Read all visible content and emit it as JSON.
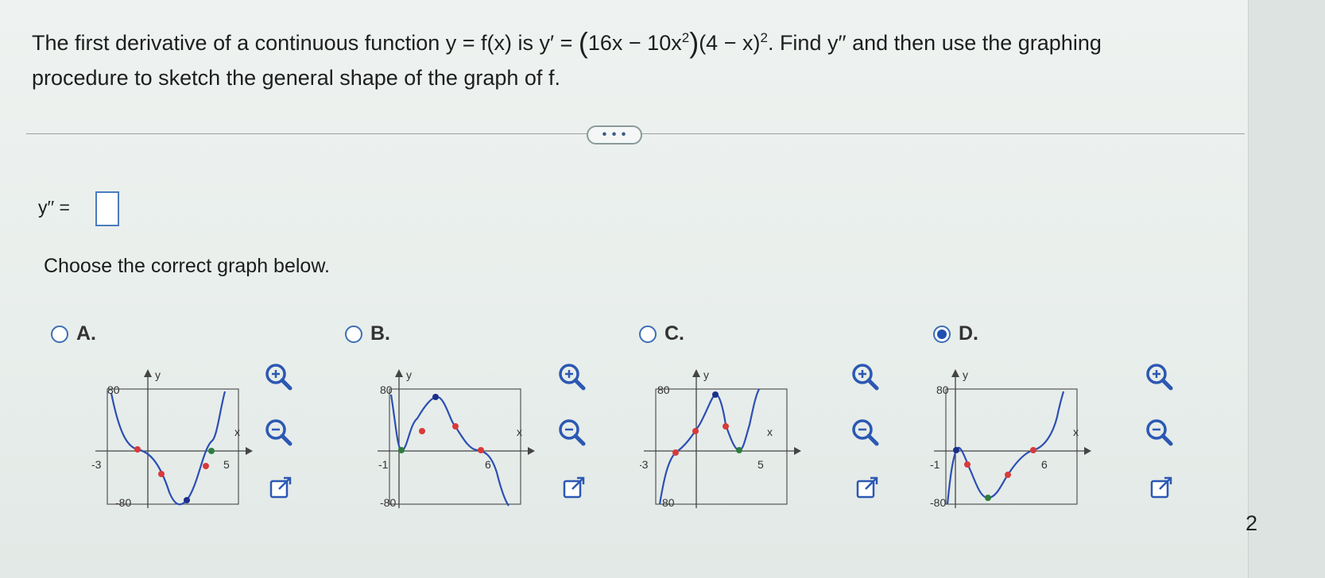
{
  "question": {
    "part1": "The first derivative of a continuous function y = f(x) is y′ = ",
    "factor1": "16x − 10x",
    "exp1": "2",
    "factor2": "(4 − x)",
    "exp2": "2",
    "part2": ". Find y′′ and then use the graphing procedure to sketch the general shape of the graph of f."
  },
  "more_button": "• • •",
  "answer": {
    "label": "y′′ =",
    "value": ""
  },
  "choose_prompt": "Choose the correct graph below.",
  "options": [
    {
      "label": "A.",
      "selected": false,
      "axis": {
        "x": "x",
        "y": "y",
        "ymax": "80",
        "ymin": "-80",
        "xmin": "-3",
        "xmax": "5"
      }
    },
    {
      "label": "B.",
      "selected": false,
      "axis": {
        "x": "x",
        "y": "y",
        "ymax": "80",
        "ymin": "-80",
        "xmin": "-1",
        "xmax": "6"
      }
    },
    {
      "label": "C.",
      "selected": false,
      "axis": {
        "x": "x",
        "y": "y",
        "ymax": "80",
        "ymin": "80",
        "xmin": "-3",
        "xmax": "5"
      }
    },
    {
      "label": "D.",
      "selected": true,
      "axis": {
        "x": "x",
        "y": "y",
        "ymax": "80",
        "ymin": "-80",
        "xmin": "-1",
        "xmax": "6"
      }
    }
  ],
  "tools": [
    "zoom-in-icon",
    "zoom-out-icon",
    "popout-icon"
  ],
  "colors": {
    "curve": "#2c4fb4",
    "point_red": "#d93a3a",
    "point_green": "#2e7d3e",
    "point_blue": "#1b2f8a",
    "radio": "#3c6eb3"
  },
  "page_number": "2"
}
